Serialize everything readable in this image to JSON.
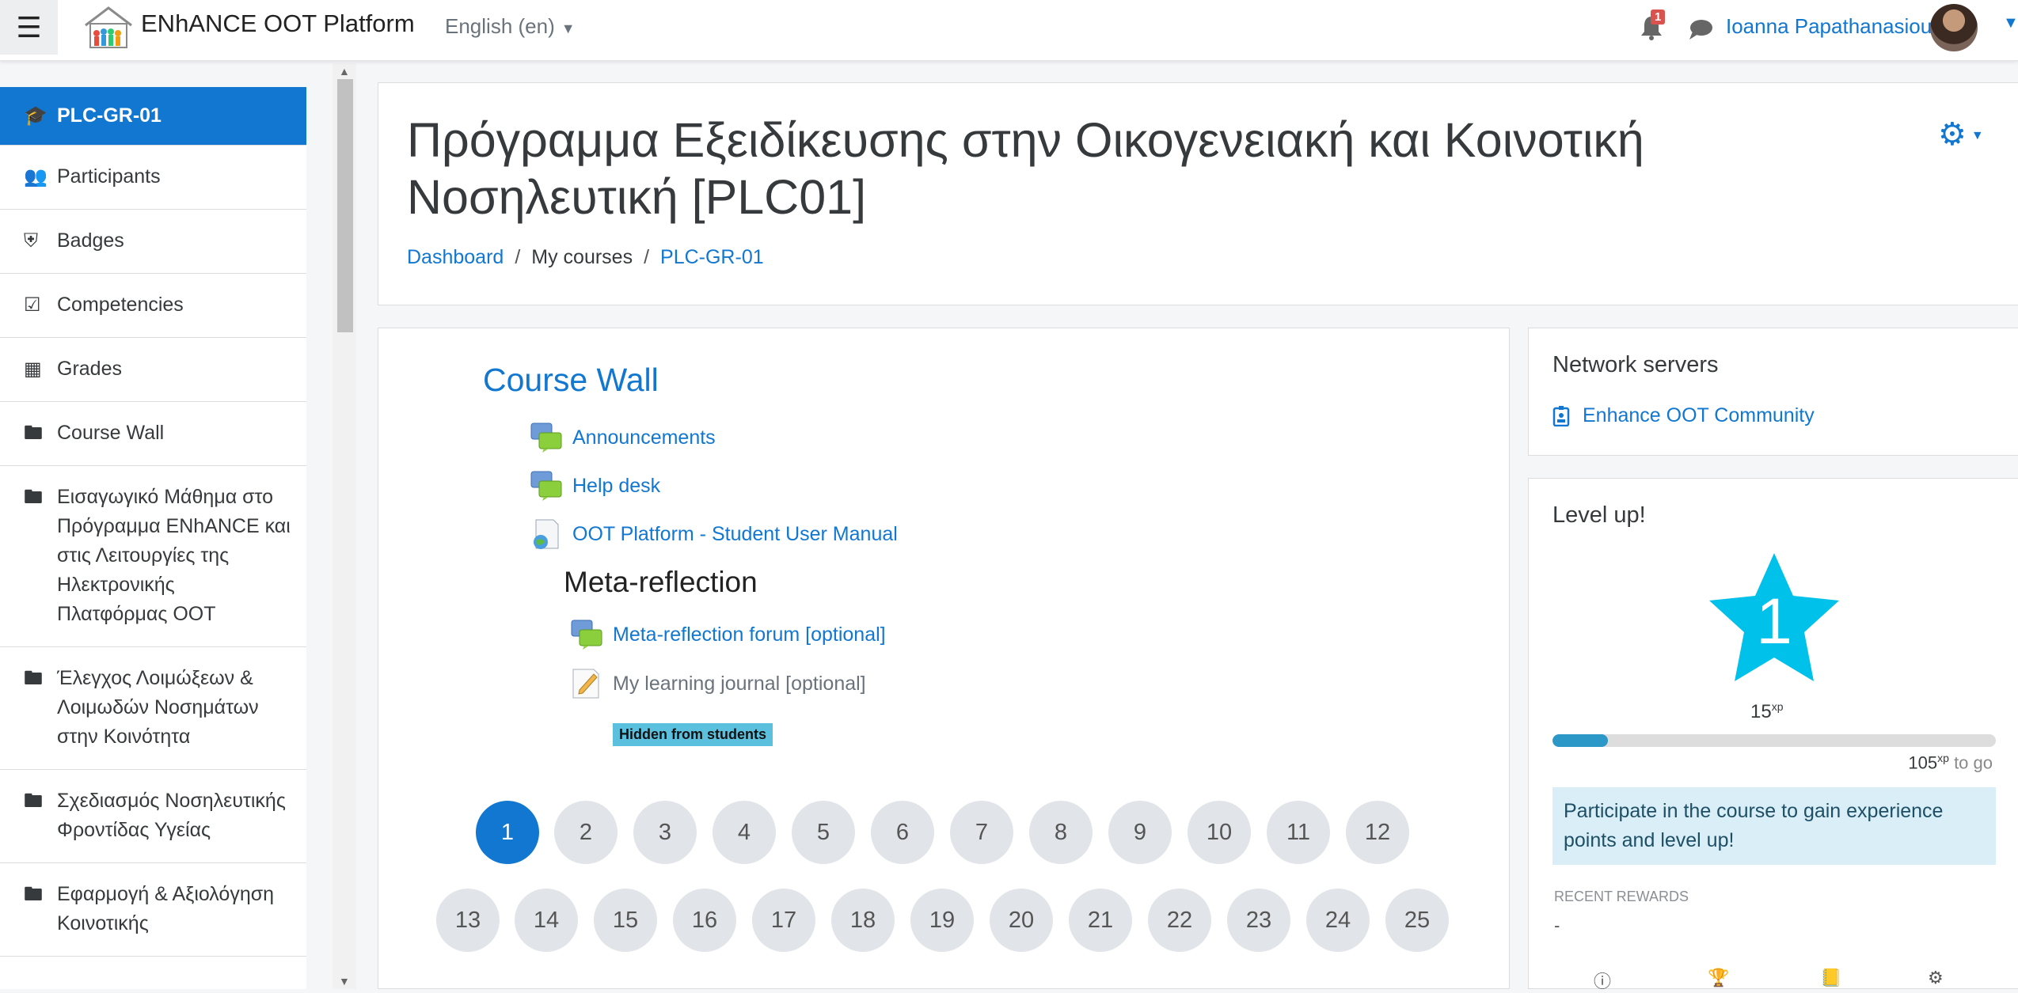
{
  "navbar": {
    "menu_icon": "hamburger-icon",
    "site_name": "ENhANCE OOT Platform",
    "language": "English (en)",
    "notification_count": "1",
    "username": "Ioanna Papathanasiou"
  },
  "sidebar": {
    "items": [
      {
        "label": "PLC-GR-01",
        "icon": "graduation-cap-icon",
        "active": true
      },
      {
        "label": "Participants",
        "icon": "users-icon"
      },
      {
        "label": "Badges",
        "icon": "shield-icon"
      },
      {
        "label": "Competencies",
        "icon": "check-square-icon"
      },
      {
        "label": "Grades",
        "icon": "table-icon"
      },
      {
        "label": "Course Wall",
        "icon": "folder-icon"
      },
      {
        "label": "Εισαγωγικό Μάθημα στο Πρόγραμμα ENhANCE και στις Λειτουργίες της Ηλεκτρονικής Πλατφόρμας OOT",
        "icon": "folder-icon"
      },
      {
        "label": "Έλεγχος Λοιμώξεων & Λοιμωδών Νοσημάτων στην Κοινότητα",
        "icon": "folder-icon"
      },
      {
        "label": "Σχεδιασμός Νοσηλευτικής Φροντίδας Υγείας",
        "icon": "folder-icon"
      },
      {
        "label": "Εφαρμογή & Αξιολόγηση Κοινοτικής",
        "icon": "folder-icon"
      }
    ]
  },
  "header": {
    "title": "Πρόγραμμα Εξειδίκευσης στην Οικογενειακή και Κοινοτική Νοσηλευτική [PLC01]",
    "breadcrumb": [
      "Dashboard",
      "My courses",
      "PLC-GR-01"
    ],
    "separator": "/"
  },
  "main": {
    "section_title": "Course Wall",
    "activities": [
      {
        "label": "Announcements",
        "icon": "forum-icon"
      },
      {
        "label": "Help desk",
        "icon": "forum-icon"
      },
      {
        "label": "OOT Platform - Student User Manual",
        "icon": "url-globe-icon"
      }
    ],
    "subheading": "Meta-reflection",
    "sub_activities": [
      {
        "label": "Meta-reflection forum [optional]",
        "icon": "forum-icon"
      },
      {
        "label": "My learning journal [optional]",
        "icon": "journal-icon"
      }
    ],
    "hidden_badge": "Hidden from students",
    "pages": [
      "1",
      "2",
      "3",
      "4",
      "5",
      "6",
      "7",
      "8",
      "9",
      "10",
      "11",
      "12",
      "13",
      "14",
      "15",
      "16",
      "17",
      "18",
      "19",
      "20",
      "21",
      "22",
      "23",
      "24",
      "25"
    ],
    "current_page": "1"
  },
  "network_block": {
    "title": "Network servers",
    "link": "Enhance OOT Community"
  },
  "levelup_block": {
    "title": "Level up!",
    "level": "1",
    "xp": "15",
    "xp_unit": "xp",
    "to_go_value": "105",
    "to_go_text": "to go",
    "progress_fraction": 0.125,
    "info": "Participate in the course to gain experience points and level up!",
    "recent_label": "RECENT REWARDS",
    "recent_value": "-",
    "accent_color": "#00c1ea"
  },
  "colors": {
    "primary": "#1177d1",
    "badge_red": "#d9534f",
    "info_bg": "#d9eef6"
  }
}
